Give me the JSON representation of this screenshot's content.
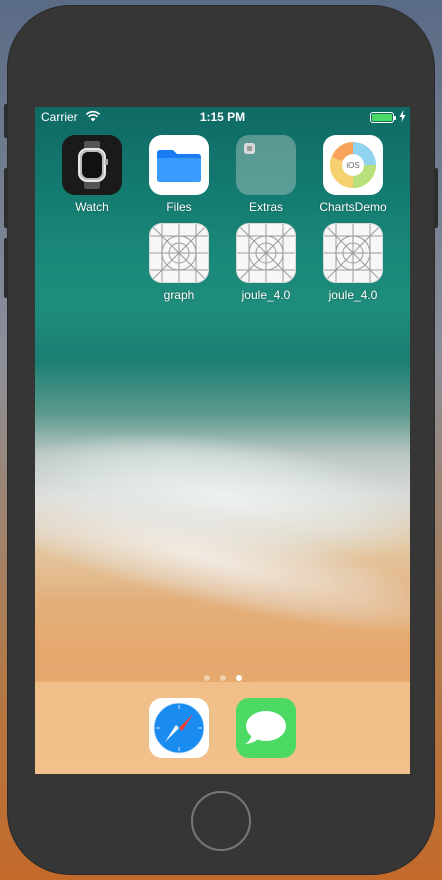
{
  "status_bar": {
    "carrier": "Carrier",
    "time": "1:15 PM",
    "battery_level_percent": 100
  },
  "home_screen": {
    "apps": [
      {
        "label": "Watch",
        "icon": "watch-icon"
      },
      {
        "label": "Files",
        "icon": "files-folder-icon"
      },
      {
        "label": "Extras",
        "icon": "extras-folder-icon"
      },
      {
        "label": "ChartsDemo",
        "icon": "charts-demo-icon",
        "badge_text": "iOS"
      },
      {
        "label": "graph",
        "icon": "placeholder-app-icon"
      },
      {
        "label": "joule_4.0",
        "icon": "placeholder-app-icon"
      },
      {
        "label": "joule_4.0",
        "icon": "placeholder-app-icon"
      }
    ],
    "page_dots": {
      "count": 3,
      "active_index": 2
    }
  },
  "dock": {
    "apps": [
      {
        "name": "Safari",
        "icon": "safari-compass-icon"
      },
      {
        "name": "Messages",
        "icon": "messages-bubble-icon"
      }
    ]
  },
  "colors": {
    "phone_body": "#363636",
    "battery_fill": "#4cd964",
    "messages_green": "#4cd964",
    "safari_blue": "#1a8cf0",
    "files_blue": "#1a7cf5"
  }
}
